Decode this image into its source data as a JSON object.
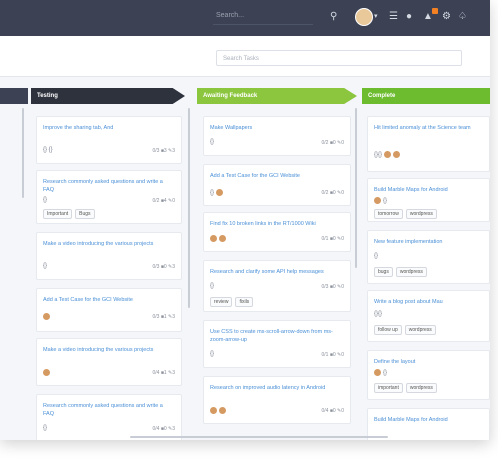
{
  "topbar": {
    "search_placeholder": "Search...",
    "icons": [
      "search-icon",
      "avatar",
      "caret-icon",
      "menu-icon",
      "chat-icon",
      "notification-icon",
      "gear-icon",
      "bell-icon"
    ],
    "notification_color": "#f48024"
  },
  "toolbar": {
    "task_search_placeholder": "Search Tasks"
  },
  "columns": {
    "left": {
      "title": ""
    },
    "testing": {
      "title": "Testing",
      "cards": [
        {
          "title": "Improve the sharing tab, And",
          "stats": "0/3 ■3 ✎3",
          "tags": []
        },
        {
          "title": "Research commonly asked questions and write a FAQ",
          "stats": "0/2 ■4 ✎0",
          "tags": [
            "Important",
            "Bugs"
          ]
        },
        {
          "title": "Make a video introducing the various projects",
          "stats": "0/3 ■0 ✎3",
          "tags": []
        },
        {
          "title": "Add a Test Case for the GCI Website",
          "stats": "0/3 ■1 ✎3",
          "tags": []
        },
        {
          "title": "Make a video introducing the various projects",
          "stats": "0/4 ■1 ✎3",
          "tags": []
        },
        {
          "title": "Research commonly asked questions and write a FAQ",
          "stats": "0/4 ■0 ✎3",
          "tags": []
        }
      ]
    },
    "awaiting": {
      "title": "Awaiting Feedback",
      "cards": [
        {
          "title": "Make Wallpapers",
          "stats": "0/2 ■0 ✎0",
          "tags": []
        },
        {
          "title": "Add a Test Case for the GCI Website",
          "stats": "0/2 ■0 ✎0",
          "tags": []
        },
        {
          "title": "Find fix 10 broken links in the RT/1000 Wiki",
          "stats": "0/1 ■0 ✎0",
          "tags": []
        },
        {
          "title": "Research and clarify some API help messages",
          "stats": "0/3 ■0 ✎0",
          "tags": [
            "review",
            "fixils"
          ]
        },
        {
          "title": "Use CSS to create ms-scroll-arrow-down from ms-zoom-arrow-up",
          "stats": "0/1 ■0 ✎0",
          "tags": []
        },
        {
          "title": "Research on improved audio latency in Android",
          "stats": "0/4 ■0 ✎0",
          "tags": []
        }
      ]
    },
    "complete": {
      "title": "Complete",
      "cards": [
        {
          "title": "Hit limited anomaly at the Science team",
          "tags": []
        },
        {
          "title": "Build Marble Maps for Android",
          "tags": [
            "tomorrow",
            "wordpress"
          ]
        },
        {
          "title": "New feature implementation",
          "tags": [
            "bugs",
            "wordpress"
          ]
        },
        {
          "title": "Write a blog post about Mau",
          "tags": [
            "follow up",
            "wordpress"
          ]
        },
        {
          "title": "Define the layout",
          "tags": [
            "important",
            "wordpress"
          ]
        },
        {
          "title": "Build Marble Maps for Android",
          "tags": []
        }
      ]
    }
  },
  "colors": {
    "topbar": "#3c4254",
    "testing_header": "#2e323d",
    "awaiting_header": "#8cc63f",
    "complete_header": "#6dbb2f",
    "link": "#4a8fd6"
  }
}
